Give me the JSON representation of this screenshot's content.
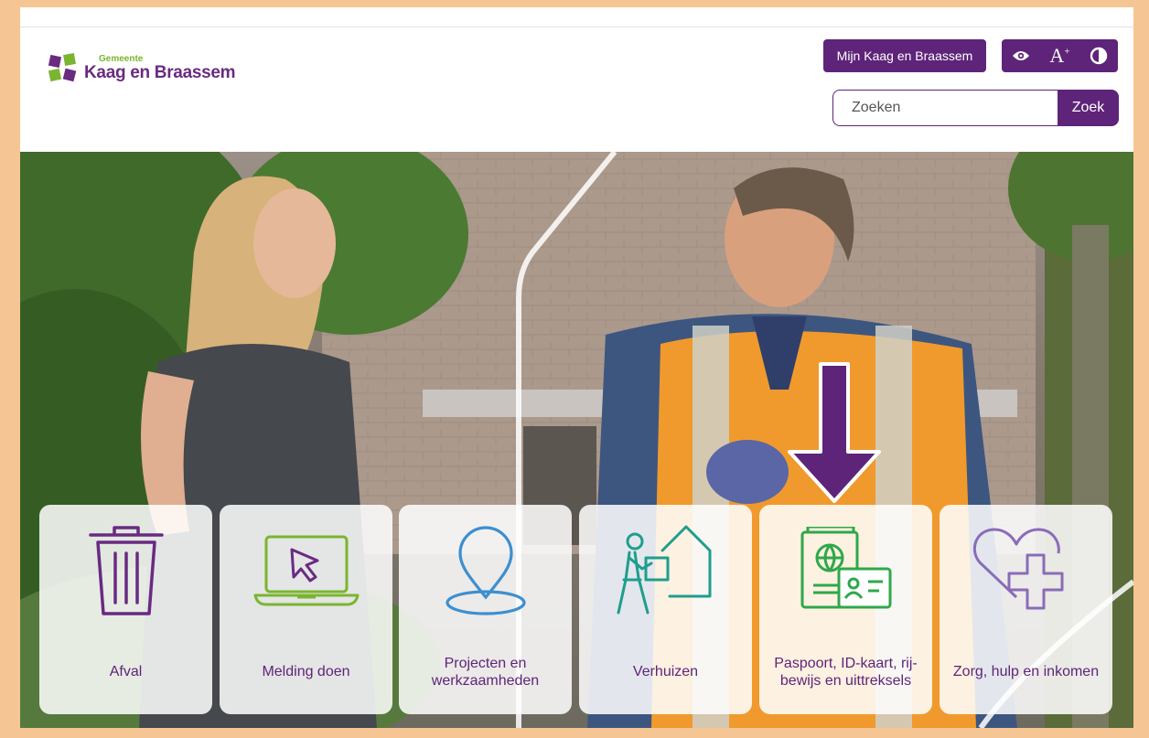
{
  "logo": {
    "small": "Gemeente",
    "main": "Kaag en Braassem"
  },
  "header": {
    "mijn_label": "Mijn Kaag en Braassem",
    "tools": {
      "eye": "eye-icon",
      "font": "A",
      "font_sup": "+",
      "contrast": "contrast-icon"
    }
  },
  "search": {
    "placeholder": "Zoeken",
    "button_label": "Zoek"
  },
  "tiles": [
    {
      "label": "Afval",
      "icon": "trash-icon"
    },
    {
      "label": "Melding doen",
      "icon": "laptop-cursor-icon"
    },
    {
      "label": "Projecten en werkzaamheden",
      "icon": "map-pin-icon"
    },
    {
      "label": "Verhuizen",
      "icon": "moving-person-icon"
    },
    {
      "label": "Paspoort, ID-kaart, rij-bewijs en uittreksels",
      "icon": "passport-id-icon"
    },
    {
      "label": "Zorg, hulp en inkomen",
      "icon": "heart-plus-icon"
    }
  ],
  "colors": {
    "brand_purple": "#5e2479",
    "brand_green": "#7ab530",
    "frame": "#f5c693"
  }
}
